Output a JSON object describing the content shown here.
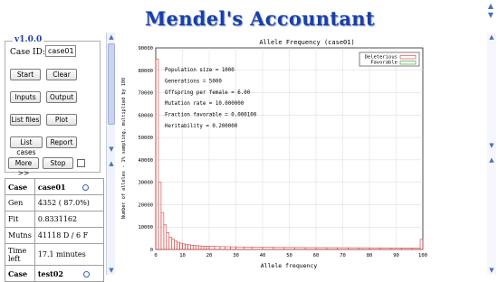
{
  "app": {
    "title": "Mendel's Accountant",
    "version": "v1.0.0"
  },
  "controls": {
    "case_id_label": "Case ID:",
    "case_id_value": "case01",
    "buttons": {
      "start": "Start",
      "clear": "Clear",
      "inputs": "Inputs",
      "output": "Output",
      "list_files": "List files",
      "plot": "Plot",
      "list_cases": "List cases",
      "report": "Report",
      "more": "More >>",
      "stop": "Stop"
    }
  },
  "status": {
    "case1_label": "Case",
    "case1_name": "case01",
    "gen_label": "Gen",
    "gen_value": "4352 ( 87.0%)",
    "fit_label": "Fit",
    "fit_value": "0.8331162",
    "mutns_label": "Mutns",
    "mutns_value": "41118 D / 6 F",
    "time_label": "Time left",
    "time_value": "17.1 minutes",
    "case2_label": "Case",
    "case2_name": "test02"
  },
  "chart_data": {
    "type": "bar",
    "title": "Allele Frequency (case01)",
    "xlabel": "Allele frequency",
    "ylabel": "Number of alleles - 1% sampling, multiplied by 100",
    "xlim": [
      0,
      100
    ],
    "ylim": [
      0,
      90000
    ],
    "x_ticks": [
      0,
      10,
      20,
      30,
      40,
      50,
      60,
      70,
      80,
      90,
      100
    ],
    "y_ticks": [
      0,
      10000,
      20000,
      30000,
      40000,
      50000,
      60000,
      70000,
      80000,
      90000
    ],
    "legend": [
      "Deleterious",
      "Favorable"
    ],
    "legend_position": "top-right",
    "colors": {
      "deleterious": "#e05050",
      "favorable": "#3ab03a"
    },
    "annotations": [
      "Population size = 1000",
      "Generations = 5000",
      "Offspring per female = 6.00",
      "Mutation rate = 10.000000",
      "Fraction favorable = 0.000100",
      "Heritability = 0.200000"
    ],
    "series": [
      {
        "name": "Deleterious",
        "bins": [
          [
            0,
            85000
          ],
          [
            1,
            30000
          ],
          [
            2,
            16500
          ],
          [
            3,
            11000
          ],
          [
            4,
            7500
          ],
          [
            5,
            5500
          ],
          [
            6,
            4600
          ],
          [
            7,
            3800
          ],
          [
            8,
            3200
          ],
          [
            9,
            2800
          ],
          [
            10,
            2500
          ],
          [
            11,
            2300
          ],
          [
            12,
            2100
          ],
          [
            13,
            1900
          ],
          [
            14,
            1800
          ],
          [
            15,
            1700
          ],
          [
            16,
            1600
          ],
          [
            17,
            1500
          ],
          [
            18,
            1450
          ],
          [
            19,
            1400
          ],
          [
            20,
            1350
          ],
          [
            22,
            1300
          ],
          [
            24,
            1250
          ],
          [
            26,
            1200
          ],
          [
            28,
            1150
          ],
          [
            30,
            1100
          ],
          [
            33,
            1050
          ],
          [
            36,
            1000
          ],
          [
            40,
            950
          ],
          [
            44,
            900
          ],
          [
            48,
            880
          ],
          [
            52,
            860
          ],
          [
            56,
            840
          ],
          [
            60,
            820
          ],
          [
            64,
            800
          ],
          [
            68,
            780
          ],
          [
            72,
            760
          ],
          [
            76,
            740
          ],
          [
            80,
            720
          ],
          [
            84,
            700
          ],
          [
            88,
            680
          ],
          [
            92,
            660
          ],
          [
            96,
            640
          ],
          [
            99,
            4500
          ]
        ]
      },
      {
        "name": "Favorable",
        "bins": []
      }
    ]
  }
}
